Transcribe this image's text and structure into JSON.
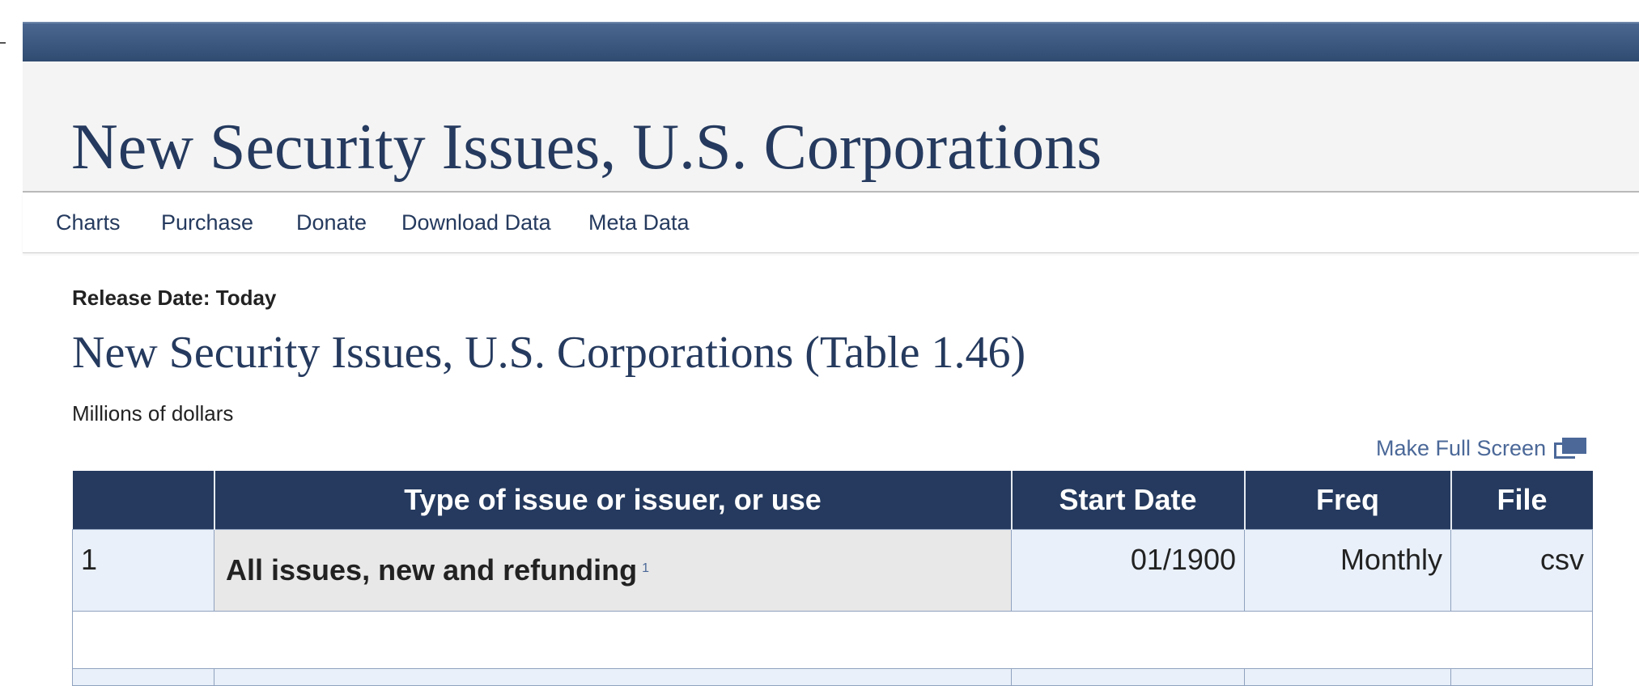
{
  "header": {
    "title": "New Security Issues, U.S. Corporations"
  },
  "nav": {
    "items": [
      {
        "label": "Charts"
      },
      {
        "label": "Purchase"
      },
      {
        "label": "Donate"
      },
      {
        "label": "Download Data"
      },
      {
        "label": "Meta Data"
      }
    ]
  },
  "content": {
    "release_date": "Release Date: Today",
    "table_title": "New Security Issues, U.S. Corporations (Table 1.46)",
    "units": "Millions of dollars",
    "full_screen_label": "Make Full Screen",
    "full_screen_icon": "fullscreen-icon"
  },
  "table": {
    "columns": [
      "",
      "Type of issue or issuer, or use",
      "Start Date",
      "Freq",
      "File"
    ],
    "rows": [
      {
        "number": "1",
        "description": "All issues, new and refunding",
        "footnote": "1",
        "start_date": "01/1900",
        "freq": "Monthly",
        "file": "csv"
      }
    ]
  },
  "colors": {
    "top_bar": "#3d5a82",
    "header_bg": "#253a5e",
    "title_text": "#253a5e",
    "link": "#4b6898",
    "row_bg": "#e9f0f9",
    "desc_bg": "#e8e8e8"
  }
}
